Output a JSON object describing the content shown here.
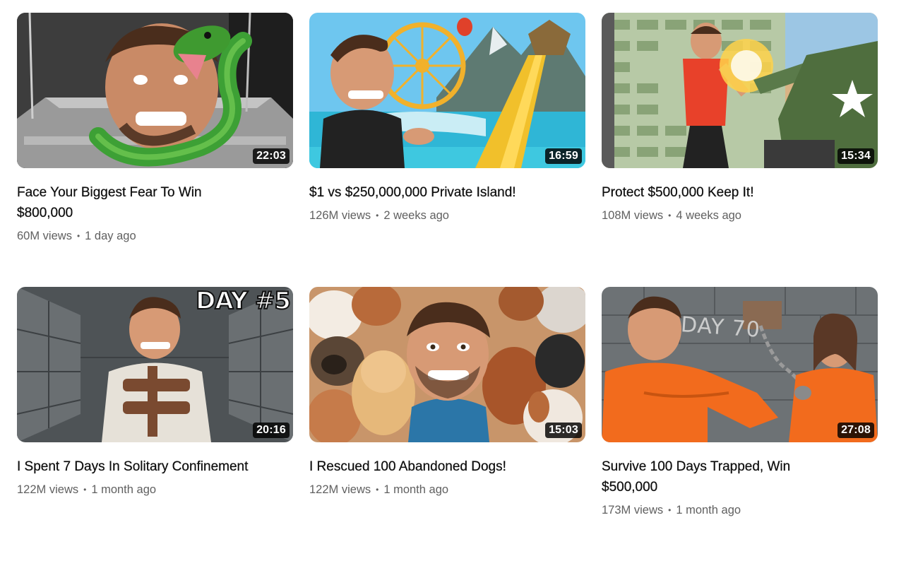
{
  "videos": [
    {
      "title": "Face Your Biggest Fear To Win $800,000",
      "views": "60M views",
      "age": "1 day ago",
      "duration": "22:03",
      "thumbnail": "snake-in-glass-box",
      "accent": "#3a8a2a"
    },
    {
      "title": "$1 vs $250,000,000 Private Island!",
      "views": "126M views",
      "age": "2 weeks ago",
      "duration": "16:59",
      "thumbnail": "tropical-island-ferris-wheel",
      "accent": "#2aa7d8"
    },
    {
      "title": "Protect $500,000 Keep It!",
      "views": "108M views",
      "age": "4 weeks ago",
      "duration": "15:34",
      "thumbnail": "money-wall-and-tank",
      "accent": "#e8412a"
    },
    {
      "title": "I Spent 7 Days In Solitary Confinement",
      "views": "122M views",
      "age": "1 month ago",
      "duration": "20:16",
      "thumbnail": "padded-cell-straitjacket",
      "accent": "#6b6b6b",
      "overlay_text": "DAY #5"
    },
    {
      "title": "I Rescued 100 Abandoned Dogs!",
      "views": "122M views",
      "age": "1 month ago",
      "duration": "15:03",
      "thumbnail": "puppies",
      "accent": "#2a6fa8"
    },
    {
      "title": "Survive 100 Days Trapped, Win $500,000",
      "views": "173M views",
      "age": "1 month ago",
      "duration": "27:08",
      "thumbnail": "prison-cell-orange-jumpsuits",
      "accent": "#f07a1c",
      "overlay_text": "DAY 70"
    }
  ],
  "separator": "•"
}
